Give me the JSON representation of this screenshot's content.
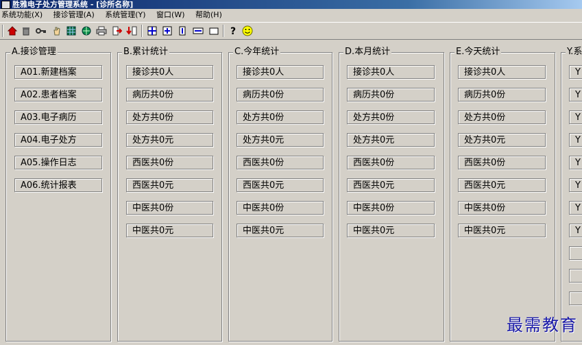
{
  "window": {
    "title": "胜雅电子处方管理系统 - [诊所名称]"
  },
  "menu": [
    "系统功能(X)",
    "接诊管理(A)",
    "系统管理(Y)",
    "窗口(W)",
    "帮助(H)"
  ],
  "toolbar": {
    "icons": [
      "house-icon",
      "trash-icon",
      "key-icon",
      "hand-icon",
      "grid-icon",
      "globe-icon",
      "printer-icon",
      "exit-icon",
      "down-arrow-icon",
      "tile-icon",
      "cascade-icon",
      "vertical-icon",
      "horizontal-icon",
      "window-icon",
      "help-icon",
      "smiley-icon"
    ]
  },
  "groups": [
    {
      "title": "A.接诊管理",
      "items": [
        "A01.新建档案",
        "A02.患者档案",
        "A03.电子病历",
        "A04.电子处方",
        "A05.操作日志",
        "A06.统计报表"
      ]
    },
    {
      "title": "B.累计统计",
      "items": [
        "接诊共0人",
        "病历共0份",
        "处方共0份",
        "处方共0元",
        "西医共0份",
        "西医共0元",
        "中医共0份",
        "中医共0元"
      ]
    },
    {
      "title": "C.今年统计",
      "items": [
        "接诊共0人",
        "病历共0份",
        "处方共0份",
        "处方共0元",
        "西医共0份",
        "西医共0元",
        "中医共0份",
        "中医共0元"
      ]
    },
    {
      "title": "D.本月统计",
      "items": [
        "接诊共0人",
        "病历共0份",
        "处方共0份",
        "处方共0元",
        "西医共0份",
        "西医共0元",
        "中医共0份",
        "中医共0元"
      ]
    },
    {
      "title": "E.今天统计",
      "items": [
        "接诊共0人",
        "病历共0份",
        "处方共0份",
        "处方共0元",
        "西医共0份",
        "西医共0元",
        "中医共0份",
        "中医共0元"
      ]
    },
    {
      "title": "Y.系",
      "items": [
        "Y",
        "Y",
        "Y",
        "Y",
        "Y",
        "Y",
        "Y",
        "Y",
        "",
        "",
        ""
      ]
    }
  ],
  "watermark": "最需教育"
}
